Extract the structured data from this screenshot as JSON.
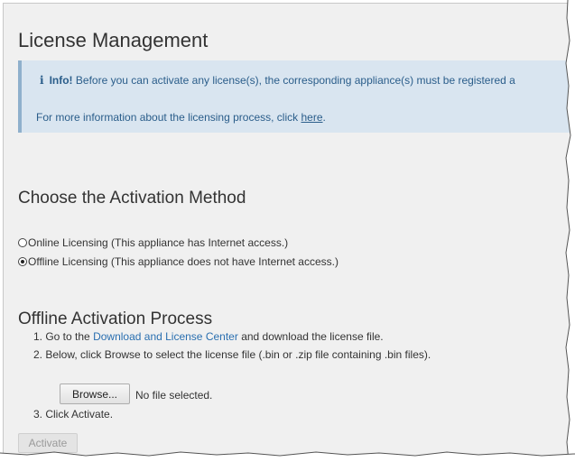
{
  "page": {
    "title": "License Management"
  },
  "info": {
    "icon": "info-icon",
    "label": "Info!",
    "message": "Before you can activate any license(s), the corresponding appliance(s) must be registered a",
    "more_text": "For more information about the licensing process, click",
    "link_text": "here",
    "link_suffix": "."
  },
  "activation_method": {
    "heading": "Choose the Activation Method",
    "options": [
      {
        "label": "Online Licensing (This appliance has Internet access.)",
        "selected": false
      },
      {
        "label": "Offline Licensing (This appliance does not have Internet access.)",
        "selected": true
      }
    ]
  },
  "offline_process": {
    "heading": "Offline Activation Process",
    "step1_prefix": "1. Go to the",
    "step1_link": "Download and License Center",
    "step1_suffix": "and download the license file.",
    "step2": "2. Below, click Browse to select the license file (.bin or .zip file containing .bin files).",
    "browse_label": "Browse...",
    "file_status": "No file selected.",
    "step3": "3. Click Activate.",
    "activate_label": "Activate"
  },
  "colors": {
    "panel_bg": "#f0f0f0",
    "info_bg": "#d9e5f0",
    "info_text": "#2a5d8a",
    "link": "#2a6fb0"
  }
}
